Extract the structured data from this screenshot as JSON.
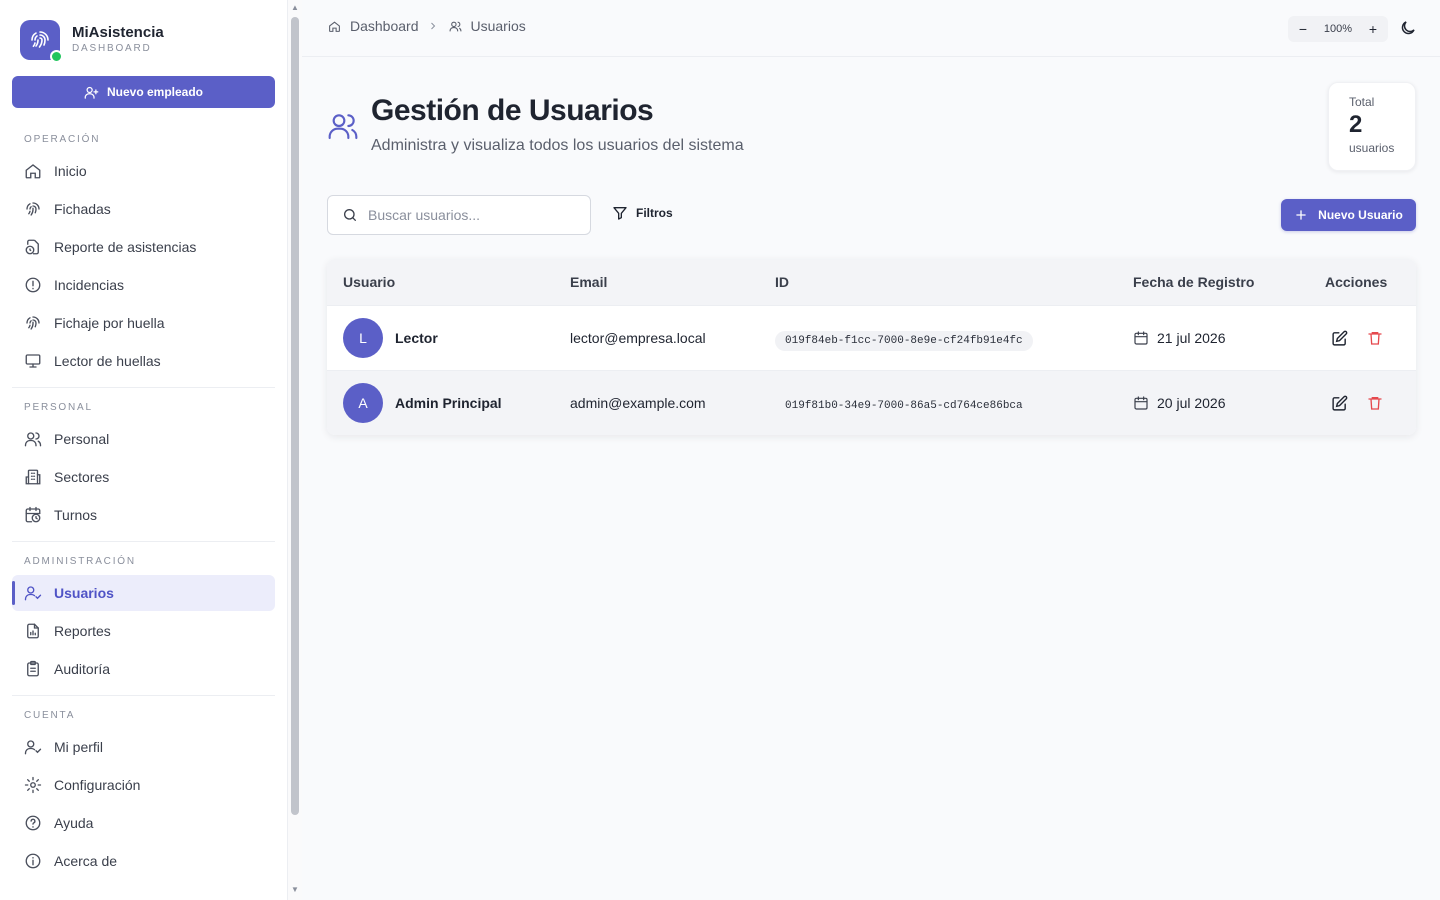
{
  "brand": {
    "name": "MiAsistencia",
    "subtitle": "DASHBOARD"
  },
  "sidebar": {
    "new_employee_label": "Nuevo empleado",
    "sections": {
      "operacion": {
        "title": "OPERACIÓN",
        "items": [
          "Inicio",
          "Fichadas",
          "Reporte de asistencias",
          "Incidencias",
          "Fichaje por huella",
          "Lector de huellas"
        ]
      },
      "personal": {
        "title": "PERSONAL",
        "items": [
          "Personal",
          "Sectores",
          "Turnos"
        ]
      },
      "administracion": {
        "title": "ADMINISTRACIÓN",
        "items": [
          "Usuarios",
          "Reportes",
          "Auditoría"
        ]
      },
      "cuenta": {
        "title": "CUENTA",
        "items": [
          "Mi perfil",
          "Configuración",
          "Ayuda",
          "Acerca de"
        ]
      }
    },
    "active_item": "Usuarios"
  },
  "topbar": {
    "breadcrumb": [
      "Dashboard",
      "Usuarios"
    ],
    "zoom_level": "100%",
    "zoom_minus": "−",
    "zoom_plus": "+"
  },
  "page": {
    "title": "Gestión de Usuarios",
    "subtitle": "Administra y visualiza todos los usuarios del sistema",
    "total": {
      "label": "Total",
      "value": "2",
      "unit": "usuarios"
    }
  },
  "toolbar": {
    "search_placeholder": "Buscar usuarios...",
    "filters_label": "Filtros",
    "new_user_label": "Nuevo Usuario"
  },
  "table": {
    "columns": [
      "Usuario",
      "Email",
      "ID",
      "Fecha de Registro",
      "Acciones"
    ],
    "rows": [
      {
        "initial": "L",
        "name": "Lector",
        "email": "lector@empresa.local",
        "id": "019f84eb-f1cc-7000-8e9e-cf24fb91e4fc",
        "date": "21 jul 2026"
      },
      {
        "initial": "A",
        "name": "Admin Principal",
        "email": "admin@example.com",
        "id": "019f81b0-34e9-7000-86a5-cd764ce86bca",
        "date": "20 jul 2026"
      }
    ]
  },
  "colors": {
    "accent": "#5b5fc7",
    "danger": "#e5484d",
    "online": "#22c55e"
  }
}
